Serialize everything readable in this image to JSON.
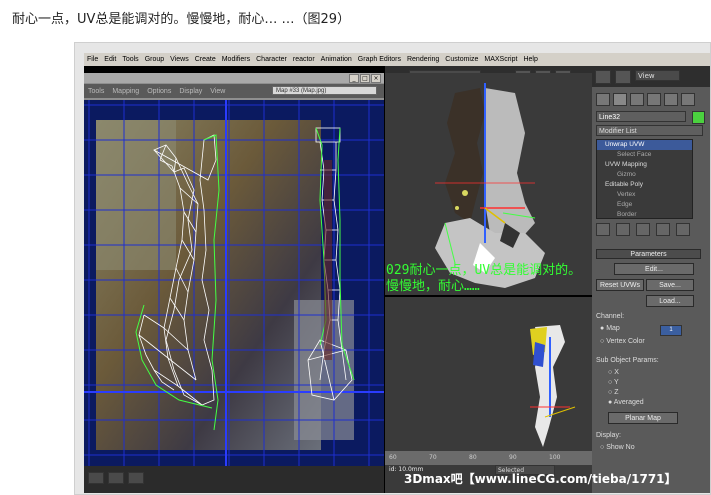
{
  "caption": "耐心一点，UV总是能调对的。慢慢地，耐心… …（图29）",
  "menu": [
    "File",
    "Edit",
    "Tools",
    "Group",
    "Views",
    "Create",
    "Modifiers",
    "Character",
    "reactor",
    "Animation",
    "Graph Editors",
    "Rendering",
    "Customize",
    "MAXScript",
    "Help"
  ],
  "uv_editor": {
    "menu": [
      "Tools",
      "Mapping",
      "Options",
      "Display",
      "View"
    ],
    "map_selector": "Map #33 (Map.jpg)"
  },
  "viewport_top": {
    "view_label": "View"
  },
  "command_panel": {
    "object_name": "Line32",
    "modifier_list": "Modifier List",
    "stack": [
      {
        "label": "Unwrap UVW",
        "selected": true,
        "sub": false
      },
      {
        "label": "Select Face",
        "selected": false,
        "sub": true
      },
      {
        "label": "UVW Mapping",
        "selected": false,
        "sub": false
      },
      {
        "label": "Gizmo",
        "selected": false,
        "sub": true
      },
      {
        "label": "Editable Poly",
        "selected": false,
        "sub": false
      },
      {
        "label": "Vertex",
        "selected": false,
        "sub": true
      },
      {
        "label": "Edge",
        "selected": false,
        "sub": true
      },
      {
        "label": "Border",
        "selected": false,
        "sub": true
      }
    ],
    "parameters_title": "Parameters",
    "edit_button": "Edit...",
    "reset_uvws": "Reset UVWs",
    "save_button": "Save...",
    "load_button": "Load...",
    "channel_label": "Channel:",
    "map_radio": "Map",
    "map_channel_value": "1",
    "vertex_color_radio": "Vertex Color",
    "sub_object_params": "Sub Object Params:",
    "axis_x": "X",
    "axis_y": "Y",
    "axis_z": "Z",
    "averaged": "Averaged",
    "planar_map": "Planar Map",
    "display_label": "Display:",
    "show_no": "Show No"
  },
  "overlay_text_line1": "029耐心一点，UV总是能调对的。",
  "overlay_text_line2": "慢慢地，耐心……",
  "timeline": {
    "ticks": [
      "60",
      "70",
      "80",
      "90",
      "100"
    ]
  },
  "status": {
    "id_text": "id: 10.0mm",
    "selected": "Selected"
  },
  "watermark": "3Dmax吧【www.lineCG.com/tieba/1771】"
}
